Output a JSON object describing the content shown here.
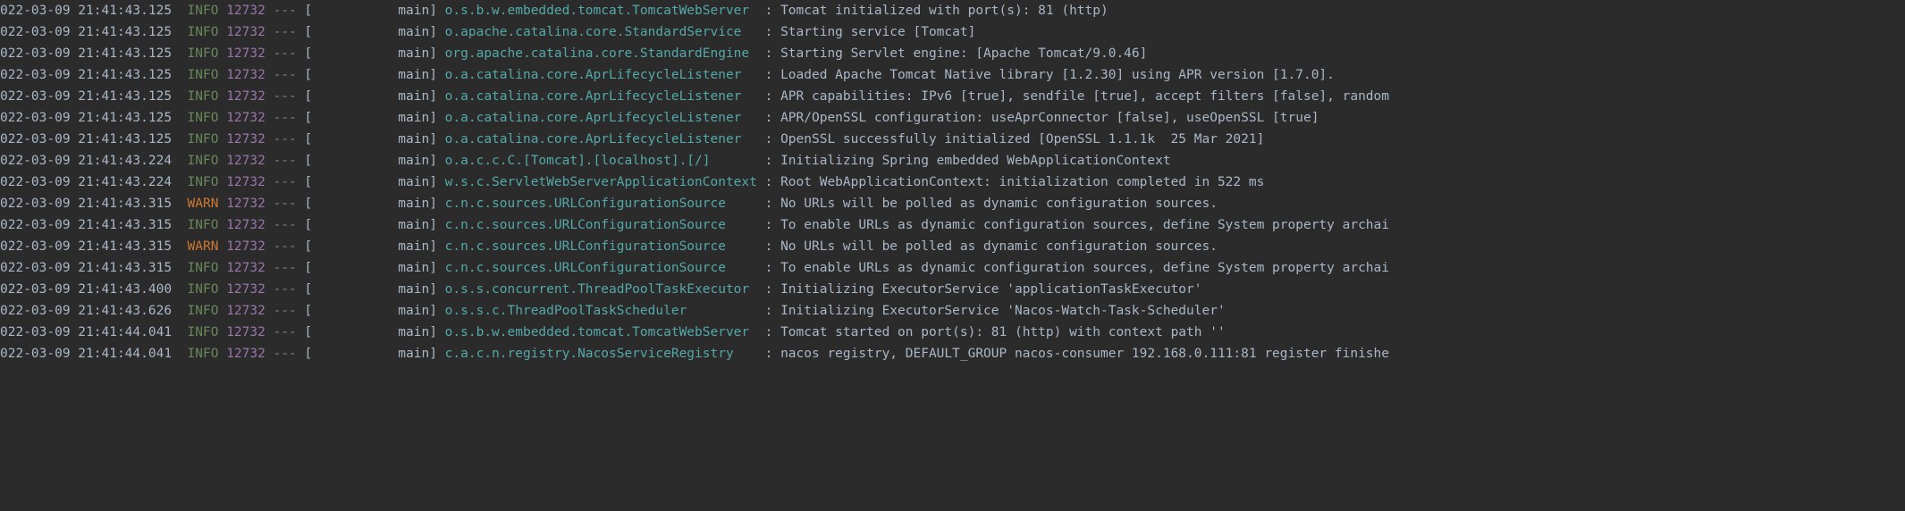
{
  "logs": [
    {
      "timestamp": "022-03-09 21:41:43.125",
      "level": "INFO",
      "pid": "12732",
      "thread": "main",
      "logger": "o.s.b.w.embedded.tomcat.TomcatWebServer",
      "message": "Tomcat initialized with port(s): 81 (http)"
    },
    {
      "timestamp": "022-03-09 21:41:43.125",
      "level": "INFO",
      "pid": "12732",
      "thread": "main",
      "logger": "o.apache.catalina.core.StandardService",
      "message": "Starting service [Tomcat]"
    },
    {
      "timestamp": "022-03-09 21:41:43.125",
      "level": "INFO",
      "pid": "12732",
      "thread": "main",
      "logger": "org.apache.catalina.core.StandardEngine",
      "message": "Starting Servlet engine: [Apache Tomcat/9.0.46]"
    },
    {
      "timestamp": "022-03-09 21:41:43.125",
      "level": "INFO",
      "pid": "12732",
      "thread": "main",
      "logger": "o.a.catalina.core.AprLifecycleListener",
      "message": "Loaded Apache Tomcat Native library [1.2.30] using APR version [1.7.0]."
    },
    {
      "timestamp": "022-03-09 21:41:43.125",
      "level": "INFO",
      "pid": "12732",
      "thread": "main",
      "logger": "o.a.catalina.core.AprLifecycleListener",
      "message": "APR capabilities: IPv6 [true], sendfile [true], accept filters [false], random"
    },
    {
      "timestamp": "022-03-09 21:41:43.125",
      "level": "INFO",
      "pid": "12732",
      "thread": "main",
      "logger": "o.a.catalina.core.AprLifecycleListener",
      "message": "APR/OpenSSL configuration: useAprConnector [false], useOpenSSL [true]"
    },
    {
      "timestamp": "022-03-09 21:41:43.125",
      "level": "INFO",
      "pid": "12732",
      "thread": "main",
      "logger": "o.a.catalina.core.AprLifecycleListener",
      "message": "OpenSSL successfully initialized [OpenSSL 1.1.1k  25 Mar 2021]"
    },
    {
      "timestamp": "022-03-09 21:41:43.224",
      "level": "INFO",
      "pid": "12732",
      "thread": "main",
      "logger": "o.a.c.c.C.[Tomcat].[localhost].[/]",
      "message": "Initializing Spring embedded WebApplicationContext"
    },
    {
      "timestamp": "022-03-09 21:41:43.224",
      "level": "INFO",
      "pid": "12732",
      "thread": "main",
      "logger": "w.s.c.ServletWebServerApplicationContext",
      "message": "Root WebApplicationContext: initialization completed in 522 ms"
    },
    {
      "timestamp": "022-03-09 21:41:43.315",
      "level": "WARN",
      "pid": "12732",
      "thread": "main",
      "logger": "c.n.c.sources.URLConfigurationSource",
      "message": "No URLs will be polled as dynamic configuration sources."
    },
    {
      "timestamp": "022-03-09 21:41:43.315",
      "level": "INFO",
      "pid": "12732",
      "thread": "main",
      "logger": "c.n.c.sources.URLConfigurationSource",
      "message": "To enable URLs as dynamic configuration sources, define System property archai"
    },
    {
      "timestamp": "022-03-09 21:41:43.315",
      "level": "WARN",
      "pid": "12732",
      "thread": "main",
      "logger": "c.n.c.sources.URLConfigurationSource",
      "message": "No URLs will be polled as dynamic configuration sources."
    },
    {
      "timestamp": "022-03-09 21:41:43.315",
      "level": "INFO",
      "pid": "12732",
      "thread": "main",
      "logger": "c.n.c.sources.URLConfigurationSource",
      "message": "To enable URLs as dynamic configuration sources, define System property archai"
    },
    {
      "timestamp": "022-03-09 21:41:43.400",
      "level": "INFO",
      "pid": "12732",
      "thread": "main",
      "logger": "o.s.s.concurrent.ThreadPoolTaskExecutor",
      "message": "Initializing ExecutorService 'applicationTaskExecutor'"
    },
    {
      "timestamp": "022-03-09 21:41:43.626",
      "level": "INFO",
      "pid": "12732",
      "thread": "main",
      "logger": "o.s.s.c.ThreadPoolTaskScheduler",
      "message": "Initializing ExecutorService 'Nacos-Watch-Task-Scheduler'"
    },
    {
      "timestamp": "022-03-09 21:41:44.041",
      "level": "INFO",
      "pid": "12732",
      "thread": "main",
      "logger": "o.s.b.w.embedded.tomcat.TomcatWebServer",
      "message": "Tomcat started on port(s): 81 (http) with context path ''"
    },
    {
      "timestamp": "022-03-09 21:41:44.041",
      "level": "INFO",
      "pid": "12732",
      "thread": "main",
      "logger": "c.a.c.n.registry.NacosServiceRegistry",
      "message": "nacos registry, DEFAULT_GROUP nacos-consumer 192.168.0.111:81 register finishe"
    }
  ]
}
